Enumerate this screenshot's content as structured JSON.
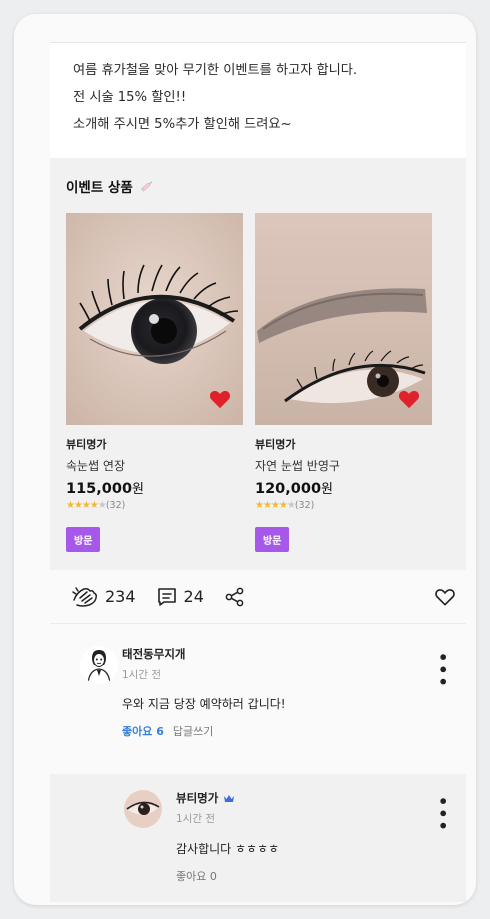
{
  "notice": {
    "line1": "여름 휴가철을 맞아 무기한 이벤트를 하고자 합니다.",
    "line2": "전 시술 15% 할인!!",
    "line3": "소개해 주시면 5%추가 할인해 드려요~"
  },
  "events": {
    "title": "이벤트 상품",
    "products": [
      {
        "brand": "뷰티명가",
        "name": "속눈썹 연장",
        "price": "115,000",
        "currency": "원",
        "rating_stars": 4,
        "reviews": "(32)",
        "tag": "방문"
      },
      {
        "brand": "뷰티명가",
        "name": "자연 눈썹 반영구",
        "price": "120,000",
        "currency": "원",
        "rating_stars": 4,
        "reviews": "(32)",
        "tag": "방문"
      }
    ]
  },
  "actions": {
    "clap_count": "234",
    "comment_count": "24"
  },
  "comments": [
    {
      "author": "태전동무지개",
      "time": "1시간 전",
      "text": "우와 지금 당장 예약하러 갑니다!",
      "like_label": "좋아요 6",
      "reply_label": "답글쓰기"
    }
  ],
  "reply": {
    "author": "뷰티명가",
    "time": "1시간 전",
    "text": "감사합니다 ㅎㅎㅎㅎ",
    "like_label": "좋아요 0"
  },
  "colors": {
    "tag_purple": "#a659e8",
    "heart_red": "#e0202a",
    "like_blue": "#3a7fd8",
    "star_gold": "#f5b82e"
  }
}
